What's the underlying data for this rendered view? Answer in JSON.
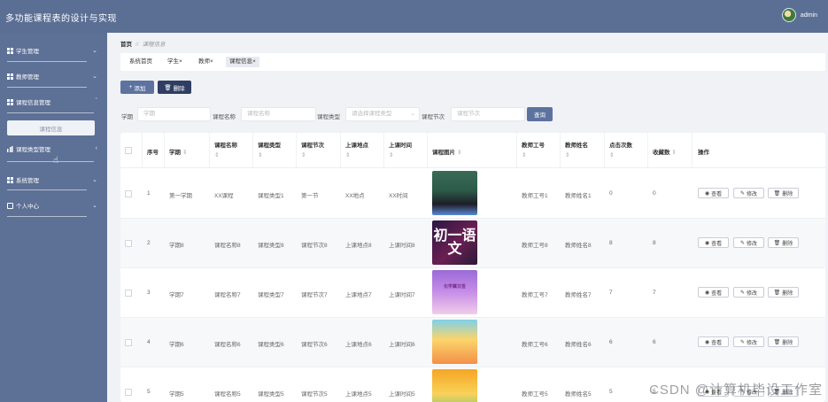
{
  "app": {
    "title": "多功能课程表的设计与实现",
    "user": "admin"
  },
  "sidebar": {
    "items": [
      {
        "label": "学生管理",
        "icon": "grid-icon"
      },
      {
        "label": "教师管理",
        "icon": "grid-icon"
      },
      {
        "label": "课程信息管理",
        "icon": "grid-icon"
      },
      {
        "label": "课程类型管理",
        "icon": "bar-chart-icon"
      },
      {
        "label": "系统管理",
        "icon": "grid-icon"
      },
      {
        "label": "个人中心",
        "icon": "user-card-icon"
      }
    ],
    "submenu_label": "课程信息"
  },
  "breadcrumb": {
    "home": "首页",
    "separator": "//",
    "current": "课程信息"
  },
  "tags": [
    {
      "label": "系统首页"
    },
    {
      "label": "学生"
    },
    {
      "label": "教师"
    },
    {
      "label": "课程信息"
    }
  ],
  "tag_close": "×",
  "actions": {
    "add": "添加",
    "delete": "删除"
  },
  "filters": [
    {
      "label": "学期",
      "placeholder": "学期"
    },
    {
      "label": "课程名称",
      "placeholder": "课程名称"
    },
    {
      "label": "课程类型",
      "placeholder": "请选择课程类型"
    },
    {
      "label": "课程节次",
      "placeholder": "课程节次"
    }
  ],
  "search_button": "查询",
  "table": {
    "columns": [
      "序号",
      "学期",
      "课程名称",
      "课程类型",
      "课程节次",
      "上课地点",
      "上课时间",
      "课程图片",
      "教师工号",
      "教师姓名",
      "点击次数",
      "收藏数",
      "操作"
    ],
    "sort_glyph": "⇕",
    "rows": [
      {
        "no": "1",
        "term": "第一学期",
        "name": "XX课程",
        "type": "课程类型1",
        "section": "第一节",
        "place": "XX地点",
        "time": "XX时间",
        "img_text": "",
        "teacher_no": "教师工号1",
        "teacher_name": "教师姓名1",
        "clicks": "0",
        "favorites": "0"
      },
      {
        "no": "2",
        "term": "学期8",
        "name": "课程名称8",
        "type": "课程类型8",
        "section": "课程节次8",
        "place": "上课地点8",
        "time": "上课时间8",
        "img_text": "初一语文",
        "teacher_no": "教师工号8",
        "teacher_name": "教师姓名8",
        "clicks": "8",
        "favorites": "8"
      },
      {
        "no": "3",
        "term": "学期7",
        "name": "课程名称7",
        "type": "课程类型7",
        "section": "课程节次7",
        "place": "上课地点7",
        "time": "上课时间7",
        "img_text": "化学翼日签",
        "teacher_no": "教师工号7",
        "teacher_name": "教师姓名7",
        "clicks": "7",
        "favorites": "7"
      },
      {
        "no": "4",
        "term": "学期6",
        "name": "课程名称6",
        "type": "课程类型6",
        "section": "课程节次6",
        "place": "上课地点6",
        "time": "上课时间6",
        "img_text": "",
        "teacher_no": "教师工号6",
        "teacher_name": "教师姓名6",
        "clicks": "6",
        "favorites": "6"
      },
      {
        "no": "5",
        "term": "学期5",
        "name": "课程名称5",
        "type": "课程类型5",
        "section": "课程节次5",
        "place": "上课地点5",
        "time": "上课时间5",
        "img_text": "",
        "teacher_no": "教师工号5",
        "teacher_name": "教师姓名5",
        "clicks": "5",
        "favorites": "5"
      }
    ],
    "row_actions": {
      "view": "查看",
      "edit": "修改",
      "delete": "删除"
    }
  },
  "watermark": "CSDN @计算机毕设工作室",
  "colors": {
    "topbar": "#5b6f95",
    "sidebar": "#5d7096",
    "primary": "#5e72a0",
    "dark": "#2f3e62"
  }
}
